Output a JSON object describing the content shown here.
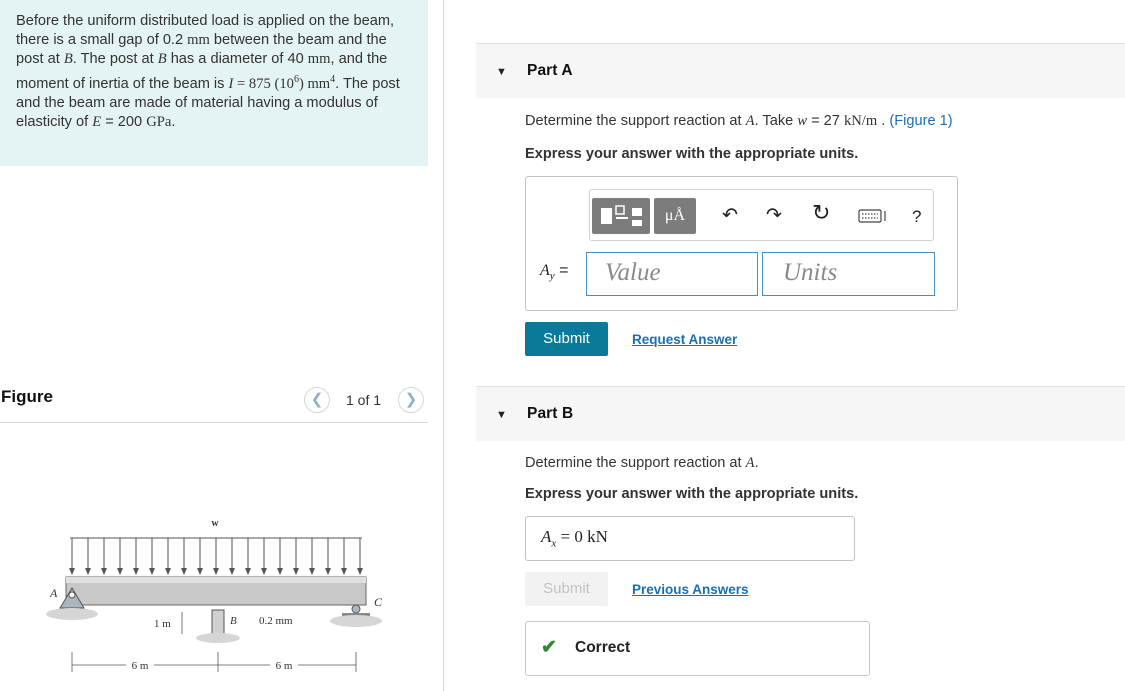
{
  "problem": {
    "segments": [
      {
        "t": "Before the uniform distributed load is applied on the beam, there is a small gap of 0.2 ",
        "c": ""
      },
      {
        "t": "mm",
        "c": "mroman"
      },
      {
        "t": " between the beam and the post at ",
        "c": ""
      },
      {
        "t": "B",
        "c": "math"
      },
      {
        "t": ". The post at ",
        "c": ""
      },
      {
        "t": "B",
        "c": "math"
      },
      {
        "t": " has a diameter of 40 ",
        "c": ""
      },
      {
        "t": "mm",
        "c": "mroman"
      },
      {
        "t": ", and the moment of inertia of the beam is ",
        "c": ""
      },
      {
        "t": "I",
        "c": "math"
      },
      {
        "t": " = 875 (10",
        "c": "mroman"
      },
      {
        "t": "6",
        "c": "sup"
      },
      {
        "t": ") mm",
        "c": "mroman"
      },
      {
        "t": "4",
        "c": "sup"
      },
      {
        "t": ". The post and the beam are made of material having a modulus of elasticity of ",
        "c": ""
      },
      {
        "t": "E",
        "c": "math"
      },
      {
        "t": " = 200 ",
        "c": ""
      },
      {
        "t": "GPa",
        "c": "mroman"
      },
      {
        "t": ".",
        "c": ""
      }
    ]
  },
  "figure_panel": {
    "title": "Figure",
    "pager": "1 of 1",
    "prev_icon": "chevron-left-icon",
    "next_icon": "chevron-right-icon",
    "labels": {
      "load": "w",
      "a": "A",
      "b": "B",
      "c": "C",
      "post_height": "1 m",
      "gap": "0.2 mm",
      "span_left": "6 m",
      "span_right": "6 m"
    }
  },
  "partA": {
    "caret": "▼",
    "title": "Part A",
    "q_before": "Determine the support reaction at ",
    "q_point": "A",
    "q_mid": ". Take ",
    "q_var": "w",
    "q_eq": " = 27 ",
    "q_unit": "kN/m",
    "q_after": " . ",
    "figure_link": "(Figure 1)",
    "instruction": "Express your answer with the appropriate units.",
    "answer_label_var": "A",
    "answer_label_sub": "y",
    "answer_label_eq": " =",
    "value_placeholder": "Value",
    "units_placeholder": "Units",
    "submit": "Submit",
    "request_answer": "Request Answer",
    "toolbar": {
      "units_button": "μÅ",
      "icons": [
        "templates-icon",
        "units-icon",
        "undo-icon",
        "redo-icon",
        "reset-icon",
        "keyboard-icon",
        "help-icon"
      ],
      "help": "?"
    }
  },
  "partB": {
    "caret": "▼",
    "title": "Part B",
    "q_before": "Determine the support reaction at ",
    "q_point": "A",
    "q_after": ".",
    "instruction": "Express your answer with the appropriate units.",
    "answer_var": "A",
    "answer_sub": "x",
    "answer_rest": " =  0 kN",
    "submit": "Submit",
    "previous_answers": "Previous Answers",
    "status_icon": "check-icon",
    "status": "Correct"
  },
  "colors": {
    "problem_bg": "#e4f3f3",
    "submit_bg": "#0a7a9a",
    "link": "#1a6fb3",
    "correct": "#2f8a2f"
  }
}
